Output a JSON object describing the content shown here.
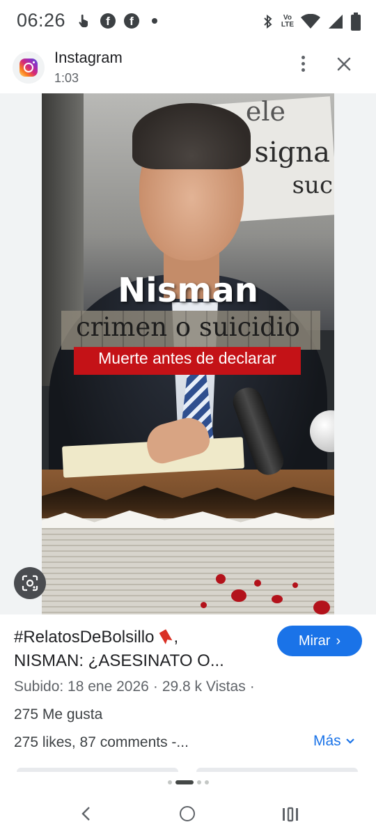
{
  "status_bar": {
    "time": "06:26",
    "left_icons": [
      "hand-pointer-icon",
      "facebook-icon",
      "facebook-icon",
      "dot-icon"
    ],
    "right_icons": [
      "bluetooth-icon",
      "volte-icon",
      "wifi-icon",
      "signal-icon",
      "battery-icon"
    ],
    "volte_line1": "Vo",
    "volte_line2": "LTE",
    "fb_glyph": "f"
  },
  "notification": {
    "app_name": "Instagram",
    "duration": "1:03"
  },
  "poster": {
    "title": "Nisman",
    "subtitle": "crimen o suicidio",
    "banner": "Muerte antes de declarar",
    "bg_text_1": "signa",
    "bg_text_2": "suc",
    "bg_text_3": "ele"
  },
  "video": {
    "title_line1": "#RelatosDeBolsillo",
    "title_line2": "NISMAN: ¿ASESINATO O...",
    "title_comma": ",",
    "watch_label": "Mirar",
    "watch_chevron": "›",
    "uploaded": "Subido: 18 ene 2026",
    "views": "29.8 k Vistas",
    "separator": "·",
    "likes": "275 Me gusta",
    "description": "275 likes, 87 comments -...",
    "more_label": "Más"
  },
  "colors": {
    "accent": "#1a73e8",
    "banner_red": "#c41217"
  }
}
